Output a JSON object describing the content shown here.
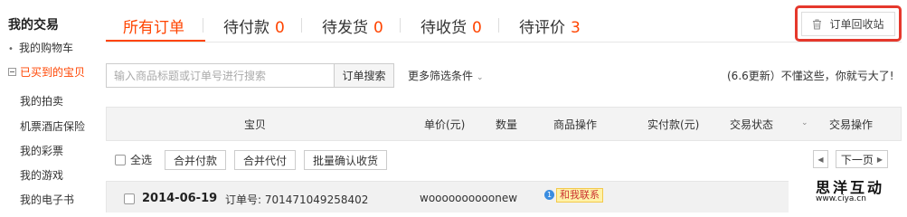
{
  "sidebar": {
    "title": "我的交易",
    "items": [
      {
        "label": "我的购物车"
      },
      {
        "label": "已买到的宝贝"
      },
      {
        "label": "我的拍卖"
      },
      {
        "label": "机票酒店保险"
      },
      {
        "label": "我的彩票"
      },
      {
        "label": "我的游戏"
      },
      {
        "label": "我的电子书"
      }
    ]
  },
  "tabs": [
    {
      "label": "所有订单",
      "count": ""
    },
    {
      "label": "待付款",
      "count": "0"
    },
    {
      "label": "待发货",
      "count": "0"
    },
    {
      "label": "待收货",
      "count": "0"
    },
    {
      "label": "待评价",
      "count": "3"
    }
  ],
  "recycle": {
    "label": "订单回收站",
    "icon": "trash-icon"
  },
  "search": {
    "placeholder": "输入商品标题或订单号进行搜索",
    "button": "订单搜索",
    "more_filter": "更多筛选条件",
    "notice": "(6.6更新）不懂这些，你就亏大了!"
  },
  "table": {
    "headers": [
      "宝贝",
      "单价(元)",
      "数量",
      "商品操作",
      "实付款(元)",
      "交易状态",
      "交易操作"
    ]
  },
  "batch": {
    "select_all": "全选",
    "buttons": [
      "合并付款",
      "合并代付",
      "批量确认收货"
    ],
    "next_page": "下一页"
  },
  "order": {
    "date": "2014-06-19",
    "order_no": "订单号: 701471049258402",
    "seller": "woooooooooonew",
    "chat": "和我联系"
  },
  "watermark": {
    "cn": "思洋互动",
    "url": "www.ciya.cn"
  },
  "colors": {
    "accent": "#ff4400",
    "highlight": "#e5382c"
  }
}
